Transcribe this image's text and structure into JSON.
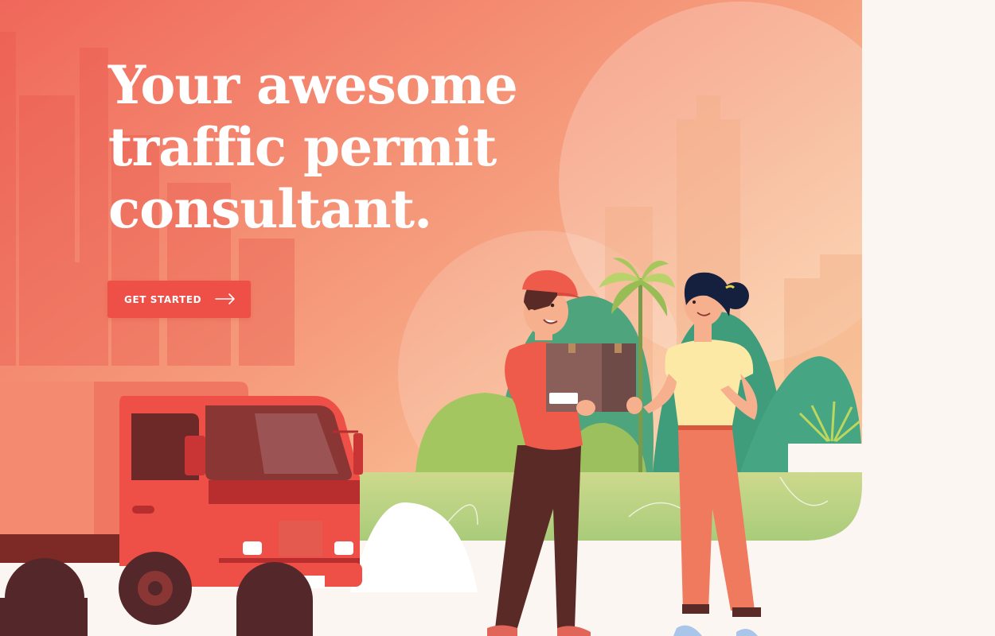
{
  "hero": {
    "headline_lines": [
      "Your awesome",
      "traffic permit",
      "consultant."
    ],
    "cta_label": "GET STARTED",
    "cta_icon": "arrow-right-icon"
  },
  "colors": {
    "accent": "#ee4f46",
    "hero_gradient_start": "#f0675a",
    "hero_gradient_end": "#fbd7a8",
    "page_background": "#fcf6f3"
  },
  "illustration": {
    "icons": [
      "city-skyline-icon",
      "delivery-truck-icon",
      "delivery-man-icon",
      "parcel-box-icon",
      "woman-customer-icon",
      "palm-tree-icon",
      "bushes-icon"
    ]
  }
}
